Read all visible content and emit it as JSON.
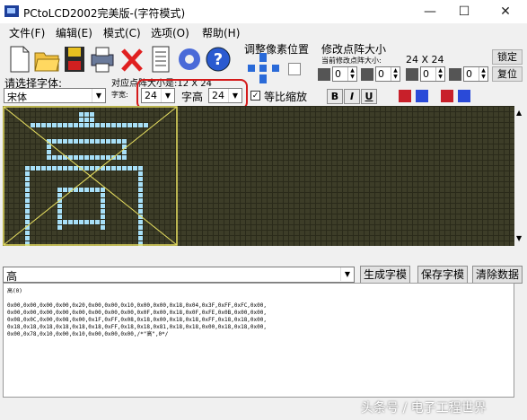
{
  "window": {
    "title": "PCtoLCD2002完美版-(字符模式)",
    "min": "—",
    "max": "☐",
    "close": "✕"
  },
  "menu": [
    "文件(F)",
    "编辑(E)",
    "模式(C)",
    "选项(O)",
    "帮助(H)"
  ],
  "labels": {
    "select_font": "请选择字体:",
    "dot_size_info": "对应点阵大小是:12 X 24",
    "char_width": "字宽:",
    "char_height": "字高",
    "proportional": "等比缩放",
    "adjust_pixel": "调整像素位置",
    "modify_dot": "修改点阵大小",
    "current_dot": "当前修改点阵大小:",
    "dot_value": "24 X 24"
  },
  "font_select": {
    "value": "宋体"
  },
  "width_select": {
    "value": "24"
  },
  "height_select": {
    "value": "24"
  },
  "spinners": [
    "0",
    "0",
    "0",
    "0",
    "0",
    "0"
  ],
  "buttons": {
    "lock": "锁定",
    "reset": "复位",
    "bold": "B",
    "italic": "I",
    "underline": "U",
    "generate": "生成字模",
    "save": "保存字模",
    "clear": "清除数据"
  },
  "input_text": "高",
  "output": {
    "line0": "高(0)",
    "line1": "0x00,0x00,0x00,0x00,0x20,0x00,0x00,0x10,0x00,0x00,0x18,0x04,0x3F,0xFF,0xFC,0x00,",
    "line2": "0x00,0x00,0x00,0x00,0x00,0x00,0x00,0x00,0x0F,0x00,0x18,0x0F,0xFE,0x0B,0x00,0x00,",
    "line3": "0x08,0x0C,0x00,0x08,0x00,0x1F,0xFF,0x08,0x18,0x00,0x18,0x18,0xFF,0x18,0x18,0x00,",
    "line4": "0x18,0x18,0x18,0x18,0x18,0x18,0xFF,0x18,0x18,0x81,0x18,0x18,0x00,0x18,0x18,0x00,",
    "line5": "0x00,0x78,0x10,0x00,0x10,0x00,0x00,0x00,/*\"高\",0*/"
  },
  "watermark": "头条号 / 电子工程世界",
  "colors": {
    "grid_bg": "#2a2a1a",
    "pixel_on": "#a8e0f8",
    "pixel_off": "#3d3d28",
    "highlight": "#d41a1a"
  }
}
